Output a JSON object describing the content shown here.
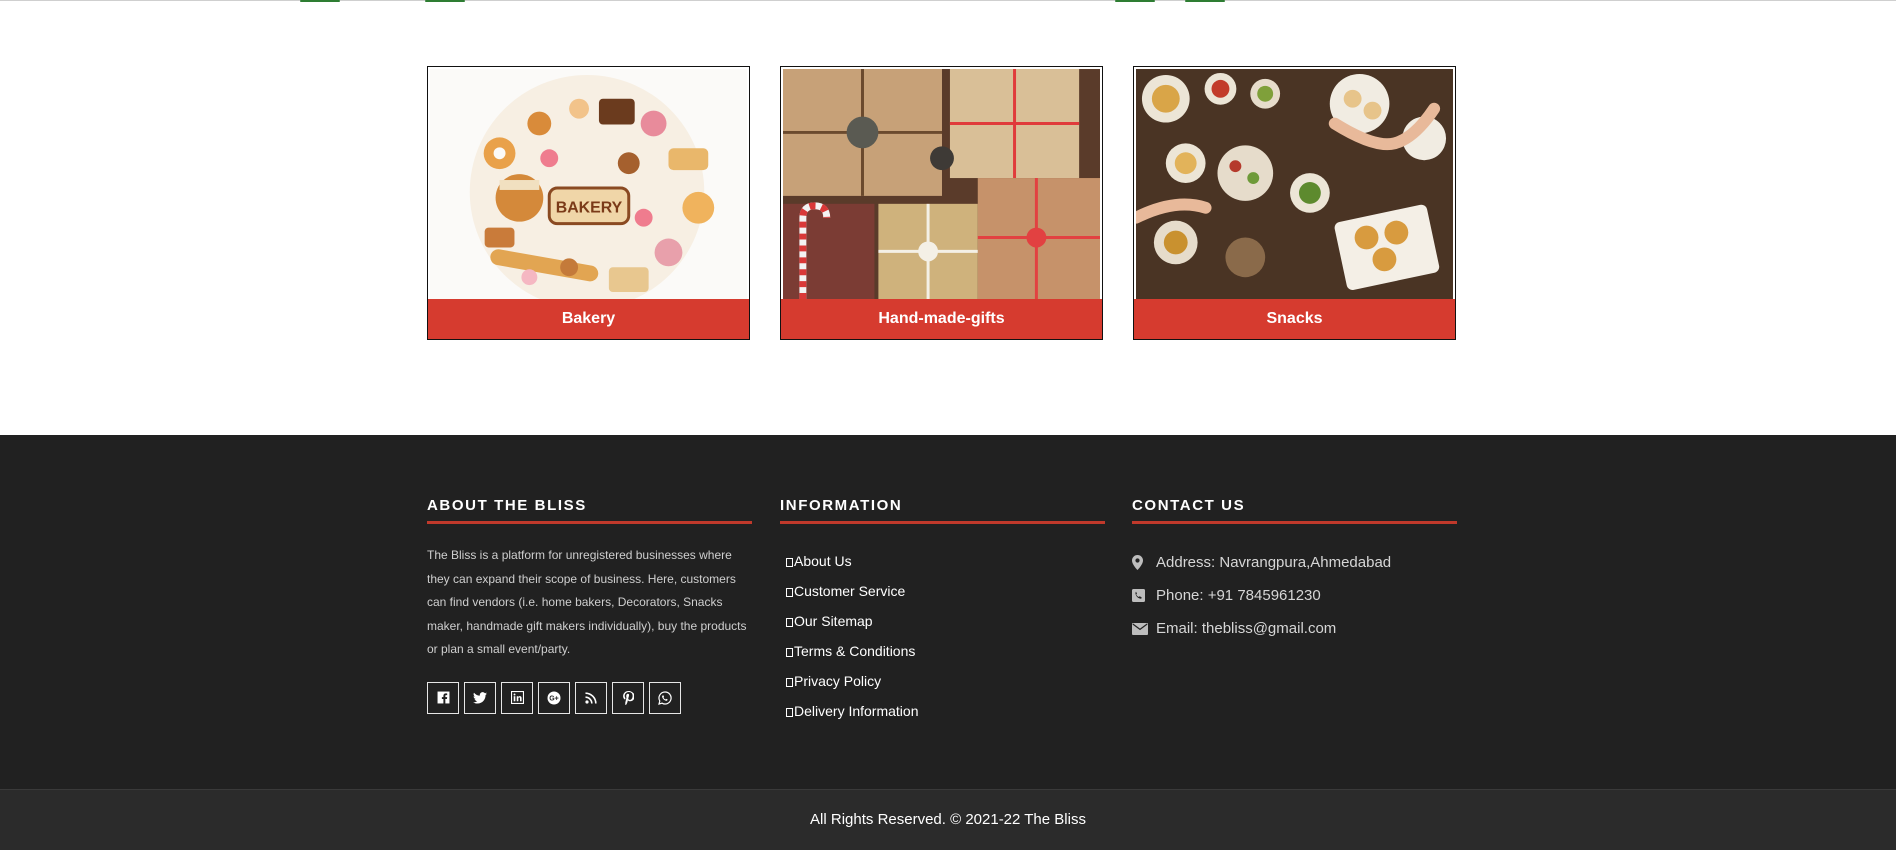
{
  "categories": [
    {
      "label": "Bakery",
      "image_icon": "bakery-image"
    },
    {
      "label": "Hand-made-gifts",
      "image_icon": "gifts-image"
    },
    {
      "label": "Snacks",
      "image_icon": "snacks-image"
    }
  ],
  "footer": {
    "about": {
      "title": "ABOUT THE BLISS",
      "text": "The Bliss is a platform for unregistered businesses where they can expand their scope of business. Here, customers can find vendors (i.e. home bakers, Decorators, Snacks maker, handmade gift makers individually), buy the products or plan a small event/party.",
      "social": [
        "facebook-icon",
        "twitter-icon",
        "linkedin-icon",
        "google-plus-icon",
        "rss-icon",
        "pinterest-icon",
        "whatsapp-icon"
      ]
    },
    "information": {
      "title": "INFORMATION",
      "links": [
        "About Us",
        "Customer Service",
        "Our Sitemap",
        "Terms & Conditions",
        "Privacy Policy",
        "Delivery Information"
      ]
    },
    "contact": {
      "title": "CONTACT US",
      "address": "Address: Navrangpura,Ahmedabad",
      "phone": "Phone: +91 7845961230",
      "email": "Email: thebliss@gmail.com"
    },
    "copyright": "All Rights Reserved. © 2021-22 The Bliss"
  },
  "colors": {
    "accent": "#d63b2f",
    "footer_bg": "#212121",
    "bottom_bg": "#2b2b2b"
  }
}
